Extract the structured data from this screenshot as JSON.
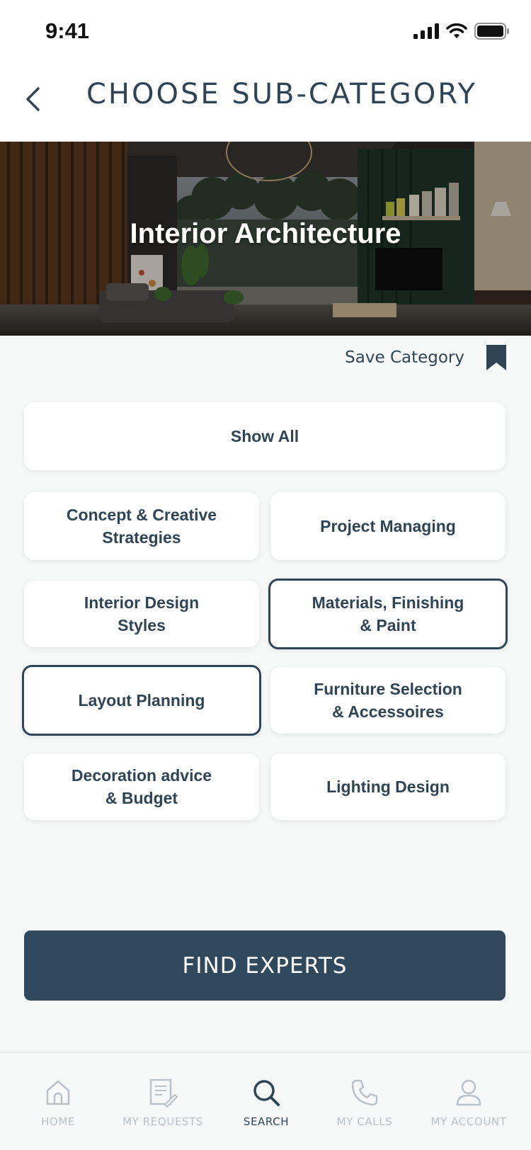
{
  "status_bar": {
    "time": "9:41"
  },
  "header": {
    "title": "CHOOSE SUB-CATEGORY"
  },
  "hero": {
    "title": "Interior Architecture"
  },
  "save": {
    "label": "Save Category"
  },
  "show_all": {
    "label": "Show All"
  },
  "subcategories": [
    {
      "label": "Concept & Creative\nStrategies",
      "selected": false
    },
    {
      "label": "Project Managing",
      "selected": false
    },
    {
      "label": "Interior Design\nStyles",
      "selected": false
    },
    {
      "label": "Materials, Finishing\n& Paint",
      "selected": true
    },
    {
      "label": "Layout Planning",
      "selected": true
    },
    {
      "label": "Furniture Selection\n& Accessoires",
      "selected": false
    },
    {
      "label": "Decoration advice\n& Budget",
      "selected": false
    },
    {
      "label": "Lighting Design",
      "selected": false
    }
  ],
  "cta": {
    "label": "FIND EXPERTS"
  },
  "tabs": [
    {
      "label": "HOME",
      "icon": "home-icon",
      "active": false
    },
    {
      "label": "MY REQUESTS",
      "icon": "requests-icon",
      "active": false
    },
    {
      "label": "SEARCH",
      "icon": "search-icon",
      "active": true
    },
    {
      "label": "MY CALLS",
      "icon": "phone-icon",
      "active": false
    },
    {
      "label": "MY ACCOUNT",
      "icon": "account-icon",
      "active": false
    }
  ],
  "colors": {
    "primary": "#30495d",
    "text": "#2f4556",
    "background": "#f7f9f9",
    "inactive": "#b9c2c8"
  }
}
